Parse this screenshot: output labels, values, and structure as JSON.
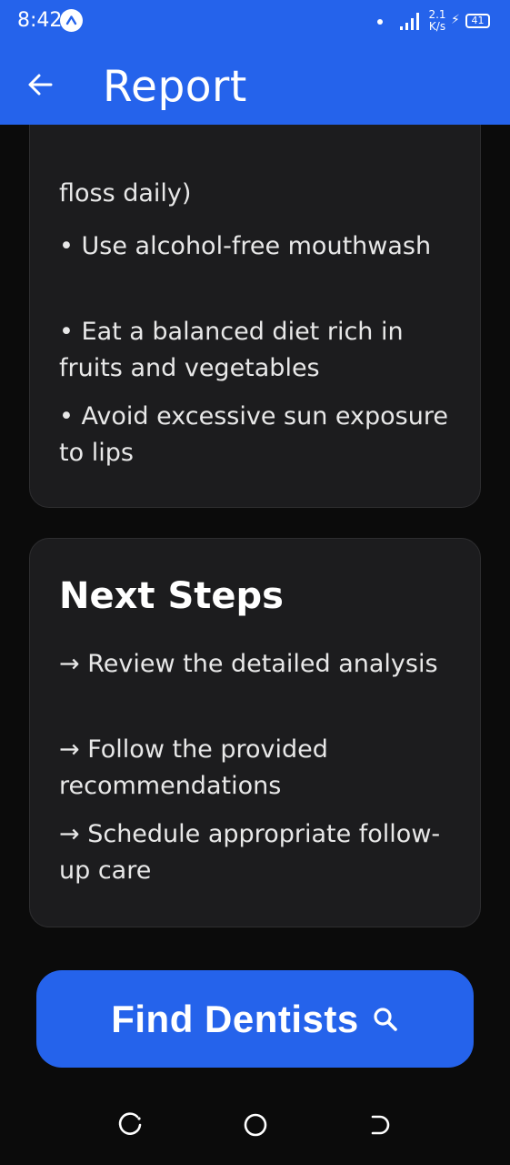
{
  "status_bar": {
    "time": "8:42",
    "network_speed_value": "2.1",
    "network_speed_unit": "K/s",
    "battery_level": "41"
  },
  "header": {
    "title": "Report",
    "background_color": "#2563eb"
  },
  "recommendations_card": {
    "cut_line": "floss daily)",
    "items": [
      "• Use alcohol-free mouthwash",
      "• Eat a balanced diet rich in fruits and vegetables",
      "• Avoid excessive sun exposure to lips"
    ]
  },
  "next_steps_card": {
    "title": "Next Steps",
    "items": [
      "→ Review the detailed analysis",
      "→ Follow the provided recommendations",
      "→ Schedule appropriate follow-up care"
    ]
  },
  "find_dentists_button": {
    "label": "Find Dentists",
    "icon": "search-icon"
  },
  "nav_bar": {
    "icons": [
      "recent-apps-icon",
      "home-icon",
      "back-nav-icon"
    ]
  }
}
